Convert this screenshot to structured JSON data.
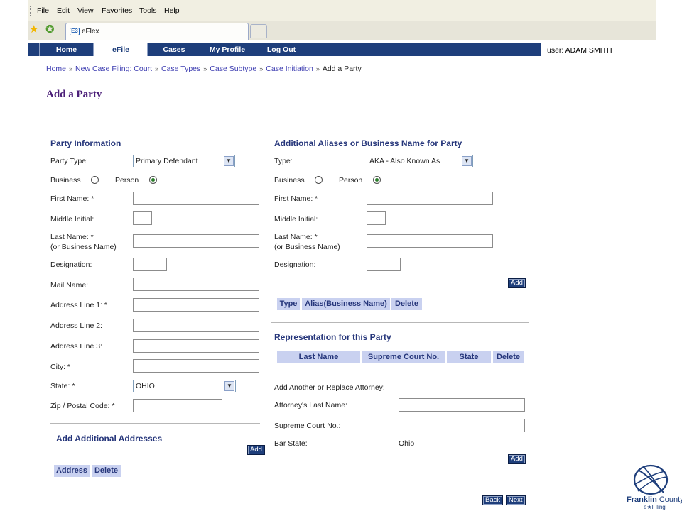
{
  "browser": {
    "menu": [
      "File",
      "Edit",
      "View",
      "Favorites",
      "Tools",
      "Help"
    ],
    "tab_title": "eFlex",
    "tab_icon": "E3"
  },
  "nav": {
    "items": [
      "Home",
      "eFile",
      "Cases",
      "My Profile",
      "Log Out"
    ],
    "active": "eFile",
    "user": "user: ADAM SMITH"
  },
  "breadcrumb": {
    "links": [
      "Home",
      "New Case Filing: Court",
      "Case Types",
      "Case Subtype",
      "Case Initiation"
    ],
    "current": "Add a Party"
  },
  "page_title": "Add a Party",
  "party_info": {
    "title": "Party Information",
    "party_type_label": "Party Type:",
    "party_type_value": "Primary Defendant",
    "business_label": "Business",
    "person_label": "Person",
    "selected_entity": "Person",
    "first_name_label": "First Name: *",
    "middle_initial_label": "Middle Initial:",
    "last_name_label": "Last Name: *",
    "last_name_sub": "(or Business Name)",
    "designation_label": "Designation:",
    "mail_name_label": "Mail Name:",
    "address1_label": "Address Line 1: *",
    "address2_label": "Address Line 2:",
    "address3_label": "Address Line 3:",
    "city_label": "City: *",
    "state_label": "State: *",
    "state_value": "OHIO",
    "zip_label": "Zip / Postal Code: *"
  },
  "addresses": {
    "title": "Add Additional Addresses",
    "add_label": "Add",
    "headers": [
      "Address",
      "Delete"
    ]
  },
  "aliases": {
    "title": "Additional Aliases or Business Name for Party",
    "type_label": "Type:",
    "type_value": "AKA - Also Known As",
    "business_label": "Business",
    "person_label": "Person",
    "selected_entity": "Person",
    "first_name_label": "First Name: *",
    "middle_initial_label": "Middle Initial:",
    "last_name_label": "Last Name: *",
    "last_name_sub": "(or Business Name)",
    "designation_label": "Designation:",
    "add_label": "Add",
    "headers": [
      "Type",
      "Alias(Business Name)",
      "Delete"
    ]
  },
  "representation": {
    "title": "Representation for this Party",
    "headers": [
      "Last Name",
      "Supreme Court No.",
      "State",
      "Delete"
    ],
    "add_replace_label": "Add Another or Replace Attorney:",
    "attorney_last_name_label": "Attorney's Last Name:",
    "supreme_court_label": "Supreme Court No.:",
    "bar_state_label": "Bar State:",
    "bar_state_value": "Ohio",
    "add_label": "Add"
  },
  "footer": {
    "back_label": "Back",
    "next_label": "Next"
  },
  "logo": {
    "name_bold": "Franklin",
    "name_rest": " County",
    "sub": "e★Filing"
  }
}
